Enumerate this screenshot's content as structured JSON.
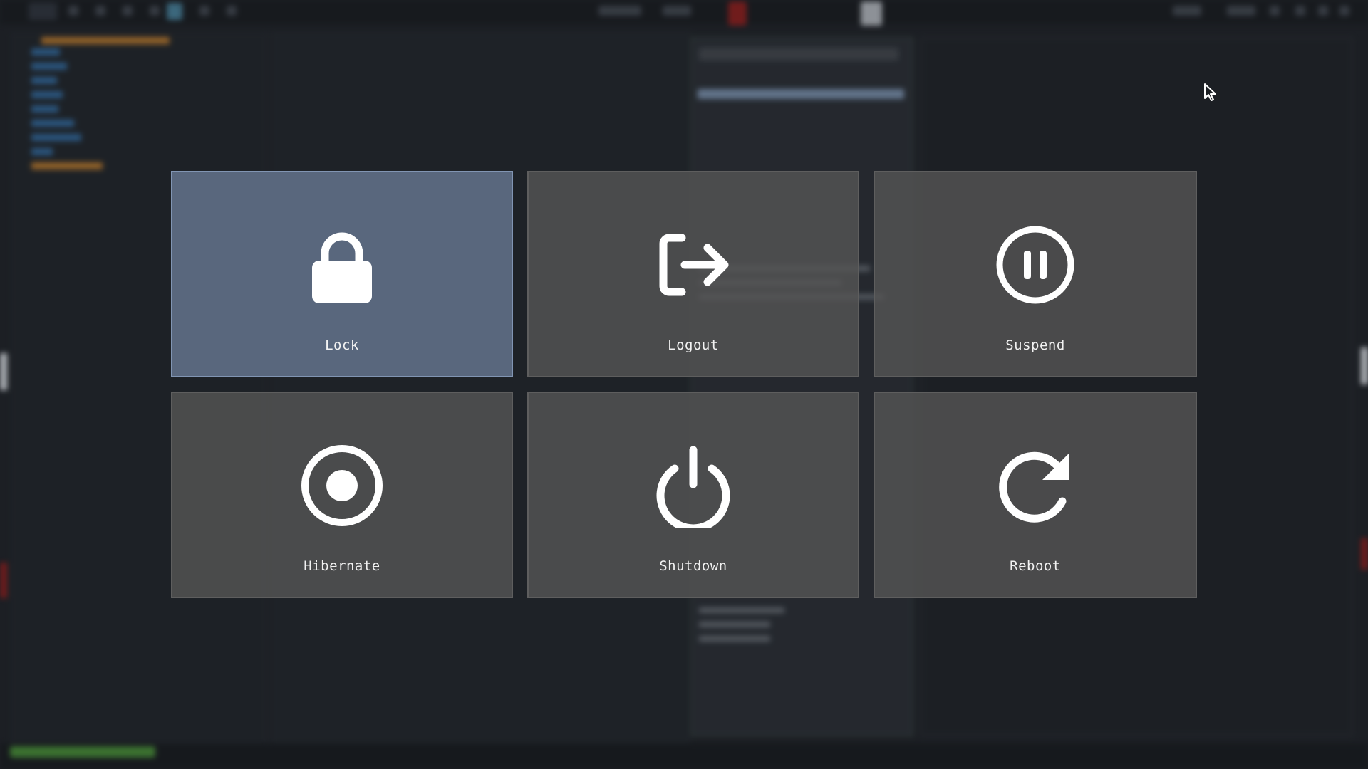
{
  "power_menu": {
    "selected": "lock",
    "options": [
      {
        "id": "lock",
        "label": "Lock",
        "icon": "lock-icon"
      },
      {
        "id": "logout",
        "label": "Logout",
        "icon": "logout-icon"
      },
      {
        "id": "suspend",
        "label": "Suspend",
        "icon": "pause-circle-icon"
      },
      {
        "id": "hibernate",
        "label": "Hibernate",
        "icon": "record-circle-icon"
      },
      {
        "id": "shutdown",
        "label": "Shutdown",
        "icon": "power-icon"
      },
      {
        "id": "reboot",
        "label": "Reboot",
        "icon": "reboot-icon"
      }
    ]
  },
  "colors": {
    "tile_background": "#545454",
    "tile_selected_background": "#5d6c82",
    "tile_selected_border": "#8195b3",
    "label_text": "#f2f2f2",
    "icon": "#ffffff"
  }
}
